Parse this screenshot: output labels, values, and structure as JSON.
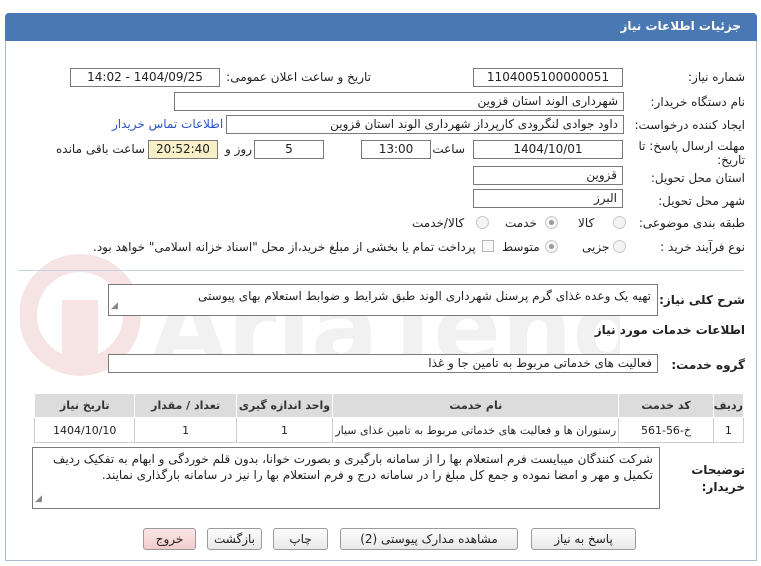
{
  "header": {
    "title": "جزئیات اطلاعات نیاز"
  },
  "fields": {
    "need_number_label": "شماره نیاز:",
    "need_number": "1104005100000051",
    "announce_label": "تاریخ و ساعت اعلان عمومی:",
    "announce_value": "1404/09/25 - 14:02",
    "buyer_org_label": "نام دستگاه خریدار:",
    "buyer_org": "شهرداری الوند استان قزوین",
    "creator_label": "ایجاد کننده درخواست:",
    "creator": "داود جوادی لنگرودی کارپرداز شهرداری الوند استان قزوین",
    "contact_link": "اطلاعات تماس خریدار",
    "deadline_label_line1": "مهلت ارسال پاسخ: تا",
    "deadline_label_line2": "تاریخ:",
    "deadline_date": "1404/10/01",
    "time_label": "ساعت",
    "deadline_time": "13:00",
    "days_value": "5",
    "days_label": "روز و",
    "remaining_value": "20:52:40",
    "remaining_label": "ساعت باقی مانده",
    "province_label": "استان محل تحویل:",
    "province": "قزوین",
    "city_label": "شهر محل تحویل:",
    "city": "البرز",
    "category_label": "طبقه بندی موضوعی:",
    "category_options": [
      "کالا",
      "خدمت",
      "کالا/خدمت"
    ],
    "category_selected": "خدمت",
    "process_label": "نوع فرآیند خرید :",
    "process_options": [
      "جزیی",
      "متوسط"
    ],
    "process_selected": "متوسط",
    "payment_note": "پرداخت تمام یا بخشی از مبلغ خرید،از محل \"اسناد خزانه اسلامی\" خواهد بود.",
    "general_desc_label": "شرح کلی نیاز:",
    "general_desc": "تهیه یک وعده غذای گرم پرسنل شهرداری الوند طبق شرایط و ضوابط استعلام بهای پیوستی",
    "services_title": "اطلاعات خدمات مورد نیاز",
    "service_group_label": "گروه خدمت:",
    "service_group": "فعالیت های خدماتی مربوط به تامین جا و غذا"
  },
  "table": {
    "headers": [
      "ردیف",
      "کد خدمت",
      "نام خدمت",
      "واحد اندازه گیری",
      "تعداد / مقدار",
      "تاریخ نیاز"
    ],
    "rows": [
      [
        "1",
        "خ-56-561",
        "رستوران ها و فعالیت های خدماتی مربوط به تامین غذای سیار",
        "1",
        "1",
        "1404/10/10"
      ]
    ]
  },
  "notes": {
    "label_line1": "توضیحات",
    "label_line2": "خریدار:",
    "text": "شرکت کنندگان میبایست فرم استعلام بها را از سامانه بارگیری و بصورت خوانا، بدون قلم خوردگی و ابهام به تفکیک ردیف تکمیل و مهر و امضا نموده و جمع کل مبلغ را در سامانه درج و فرم استعلام بها را نیز در سامانه بارگذاری نمایند."
  },
  "buttons": {
    "reply": "پاسخ به نیاز",
    "attachments": "مشاهده مدارک پیوستی (2)",
    "print": "چاپ",
    "back": "بازگشت",
    "exit": "خروج"
  },
  "watermark": {
    "text": "AriaTender.net"
  },
  "colors": {
    "title_bar": "#4a78b2",
    "remaining_bg": "#f7efc6",
    "link": "#2b55c6",
    "exit_button": "#f1cccc"
  }
}
